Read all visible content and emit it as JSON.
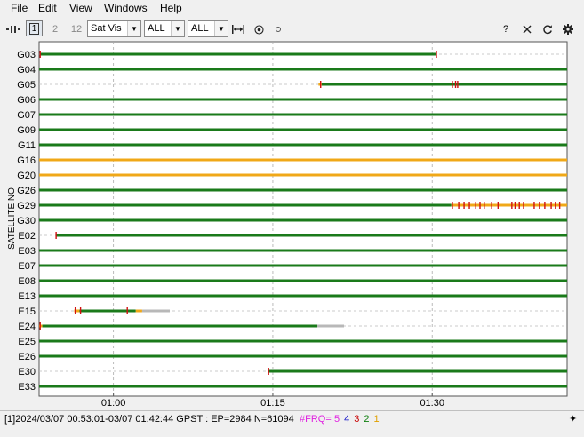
{
  "menu": [
    "File",
    "Edit",
    "View",
    "Windows",
    "Help"
  ],
  "toolbar": {
    "btn_1": "1",
    "btn_2": "2",
    "btn_12": "12",
    "plot_type": "Sat Vis",
    "system_filter": "ALL",
    "signal_filter": "ALL",
    "help_label": "?"
  },
  "chart_data": {
    "type": "timeline",
    "ylabel": "SATELLITE NO",
    "x_ticks": [
      "01:00",
      "01:15",
      "01:30"
    ],
    "x_tick_minutes": [
      60,
      75,
      90
    ],
    "x_range_minutes": [
      53.0,
      102.7
    ],
    "colors": {
      "green": "#1a7a1a",
      "orange": "#f0a818",
      "red": "#d01010",
      "gray": "#b8b8b8"
    },
    "satellites": [
      {
        "name": "G03",
        "segments": [
          [
            53.1,
            90.4,
            "green"
          ]
        ],
        "slips": [
          53.1,
          90.4
        ]
      },
      {
        "name": "G04",
        "segments": [
          [
            53.0,
            102.7,
            "green"
          ]
        ],
        "slips": []
      },
      {
        "name": "G05",
        "segments": [
          [
            79.3,
            79.6,
            "orange"
          ],
          [
            79.6,
            102.7,
            "green"
          ]
        ],
        "slips": [
          79.5,
          91.9,
          92.2,
          92.4
        ]
      },
      {
        "name": "G06",
        "segments": [
          [
            53.0,
            102.7,
            "green"
          ]
        ],
        "slips": []
      },
      {
        "name": "G07",
        "segments": [
          [
            53.0,
            102.7,
            "green"
          ]
        ],
        "slips": []
      },
      {
        "name": "G09",
        "segments": [
          [
            53.0,
            102.7,
            "green"
          ]
        ],
        "slips": []
      },
      {
        "name": "G11",
        "segments": [
          [
            53.0,
            102.7,
            "green"
          ]
        ],
        "slips": []
      },
      {
        "name": "G16",
        "segments": [
          [
            53.0,
            102.7,
            "orange"
          ]
        ],
        "slips": []
      },
      {
        "name": "G20",
        "segments": [
          [
            53.0,
            102.7,
            "orange"
          ]
        ],
        "slips": []
      },
      {
        "name": "G26",
        "segments": [
          [
            53.0,
            102.7,
            "green"
          ]
        ],
        "slips": []
      },
      {
        "name": "G29",
        "segments": [
          [
            53.0,
            91.8,
            "green"
          ],
          [
            91.8,
            102.7,
            "orange"
          ]
        ],
        "slips": [
          91.9,
          92.5,
          93.0,
          93.5,
          94.1,
          94.5,
          94.9,
          95.6,
          96.2,
          97.5,
          97.8,
          98.2,
          98.6,
          99.6,
          100.1,
          100.6,
          101.2,
          101.6,
          102.0
        ]
      },
      {
        "name": "G30",
        "segments": [
          [
            53.0,
            102.7,
            "green"
          ]
        ],
        "slips": []
      },
      {
        "name": "E02",
        "segments": [
          [
            54.6,
            102.7,
            "green"
          ]
        ],
        "slips": [
          54.6
        ]
      },
      {
        "name": "E03",
        "segments": [
          [
            53.0,
            102.7,
            "green"
          ]
        ],
        "slips": []
      },
      {
        "name": "E07",
        "segments": [
          [
            53.0,
            102.7,
            "green"
          ]
        ],
        "slips": []
      },
      {
        "name": "E08",
        "segments": [
          [
            53.0,
            102.7,
            "green"
          ]
        ],
        "slips": []
      },
      {
        "name": "E13",
        "segments": [
          [
            53.0,
            102.7,
            "green"
          ]
        ],
        "slips": []
      },
      {
        "name": "E15",
        "segments": [
          [
            56.3,
            56.8,
            "orange"
          ],
          [
            56.8,
            62.1,
            "green"
          ],
          [
            62.1,
            62.7,
            "orange"
          ],
          [
            62.7,
            65.3,
            "gray"
          ]
        ],
        "slips": [
          56.4,
          56.9,
          61.3
        ]
      },
      {
        "name": "E24",
        "segments": [
          [
            53.0,
            53.3,
            "orange"
          ],
          [
            53.3,
            79.2,
            "green"
          ],
          [
            79.2,
            81.7,
            "gray"
          ]
        ],
        "slips": [
          53.1
        ]
      },
      {
        "name": "E25",
        "segments": [
          [
            53.0,
            102.7,
            "green"
          ]
        ],
        "slips": []
      },
      {
        "name": "E26",
        "segments": [
          [
            53.0,
            102.7,
            "green"
          ]
        ],
        "slips": []
      },
      {
        "name": "E30",
        "segments": [
          [
            74.6,
            102.7,
            "green"
          ]
        ],
        "slips": [
          74.6
        ]
      },
      {
        "name": "E33",
        "segments": [
          [
            53.0,
            102.7,
            "green"
          ]
        ],
        "slips": []
      }
    ]
  },
  "status": {
    "info": "[1]2024/03/07 00:53:01-03/07 01:42:44 GPST : EP=2984 N=61094",
    "frq_label": "#FRQ=",
    "frq_values": [
      "5",
      "4",
      "3",
      "2",
      "1"
    ],
    "frq_colors": [
      "#e020e0",
      "#1010c8",
      "#c80000",
      "#108010",
      "#e0a000"
    ]
  }
}
